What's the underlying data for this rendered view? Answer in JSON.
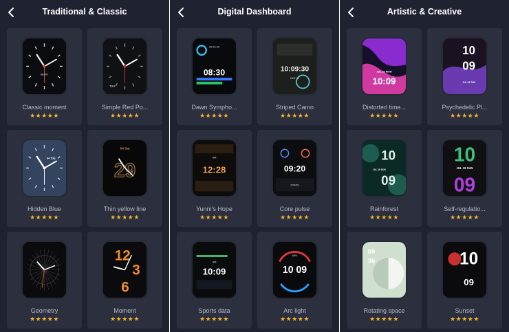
{
  "panels": [
    {
      "title": "Traditional & Classic",
      "back_icon": "chevron-left-icon",
      "faces": [
        {
          "name": "Classic moment",
          "stars": "★★★★★",
          "rating": 5,
          "label": "HEART"
        },
        {
          "name": "Simple Red Po...",
          "stars": "★★★★★",
          "rating": 5,
          "label": "THU"
        },
        {
          "name": "Hidden Blue",
          "stars": "★★★★★",
          "rating": 5,
          "label": "04 TUE"
        },
        {
          "name": "Thin yellow line",
          "stars": "★★★★★",
          "rating": 5,
          "label": "04 Sat",
          "big": "29"
        },
        {
          "name": "Geometry",
          "stars": "★★★★★",
          "rating": 5
        },
        {
          "name": "Moment",
          "stars": "★★★★★",
          "rating": 5,
          "big": "12",
          "big2": "3",
          "big3": "6"
        }
      ]
    },
    {
      "title": "Digital Dashboard",
      "back_icon": "chevron-left-icon",
      "faces": [
        {
          "name": "Dawn Sympho...",
          "stars": "★★★★★",
          "rating": 5,
          "time": "08:30",
          "label": "20-03-20"
        },
        {
          "name": "Striped Camo",
          "stars": "★★★★★",
          "rating": 5,
          "time": "10:09:30",
          "label": "OCT 29"
        },
        {
          "name": "Yunni's Hope",
          "stars": "★★★★★",
          "rating": 5,
          "time": "12:28",
          "label": "AM"
        },
        {
          "name": "Core pulse",
          "stars": "★★★★★",
          "rating": 5,
          "time": "09:20",
          "label": "STEPS"
        },
        {
          "name": "Sports data",
          "stars": "★★★★★",
          "rating": 5,
          "time": "10:09",
          "label": "AM"
        },
        {
          "name": "Arc light",
          "stars": "★★★★★",
          "rating": 5,
          "time": "10 09",
          "label": "68%"
        }
      ]
    },
    {
      "title": "Artistic & Creative",
      "back_icon": "chevron-left-icon",
      "faces": [
        {
          "name": "Distorted time...",
          "stars": "★★★★★",
          "rating": 5,
          "time": "10:09",
          "label": "JUL 23 MON"
        },
        {
          "name": "Psychedelic Pl...",
          "stars": "★★★★★",
          "rating": 5,
          "time": "10",
          "time2": "09",
          "label": "JUL 23 TUE"
        },
        {
          "name": "Rainforest",
          "stars": "★★★★★",
          "rating": 5,
          "time": "10",
          "time2": "09",
          "label": "JUL 19 SUN"
        },
        {
          "name": "Self-regulatio...",
          "stars": "★★★★★",
          "rating": 5,
          "time": "10",
          "time2": "09",
          "label": "JUL 19 SUN"
        },
        {
          "name": "Rotating space",
          "stars": "★★★★★",
          "rating": 5,
          "time": "09",
          "time2": "36"
        },
        {
          "name": "Sunset",
          "stars": "★★★★★",
          "rating": 5,
          "time": "10",
          "time2": "09"
        }
      ]
    }
  ],
  "colors": {
    "panel_bg": "#1f2230",
    "card_bg": "#2b2f3e",
    "star": "#f5b52e",
    "title": "#ffffff",
    "name": "#b9bcc6"
  }
}
